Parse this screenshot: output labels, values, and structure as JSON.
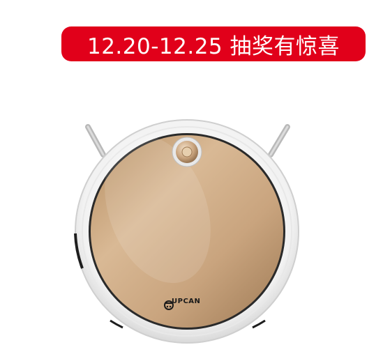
{
  "promo": {
    "text": "12.20-12.25 抽奖有惊喜"
  },
  "product": {
    "brand": "UPCAN",
    "body_color": "#c9a47e",
    "shell_color": "#f4f4f4",
    "accent_color": "#e1001a"
  }
}
